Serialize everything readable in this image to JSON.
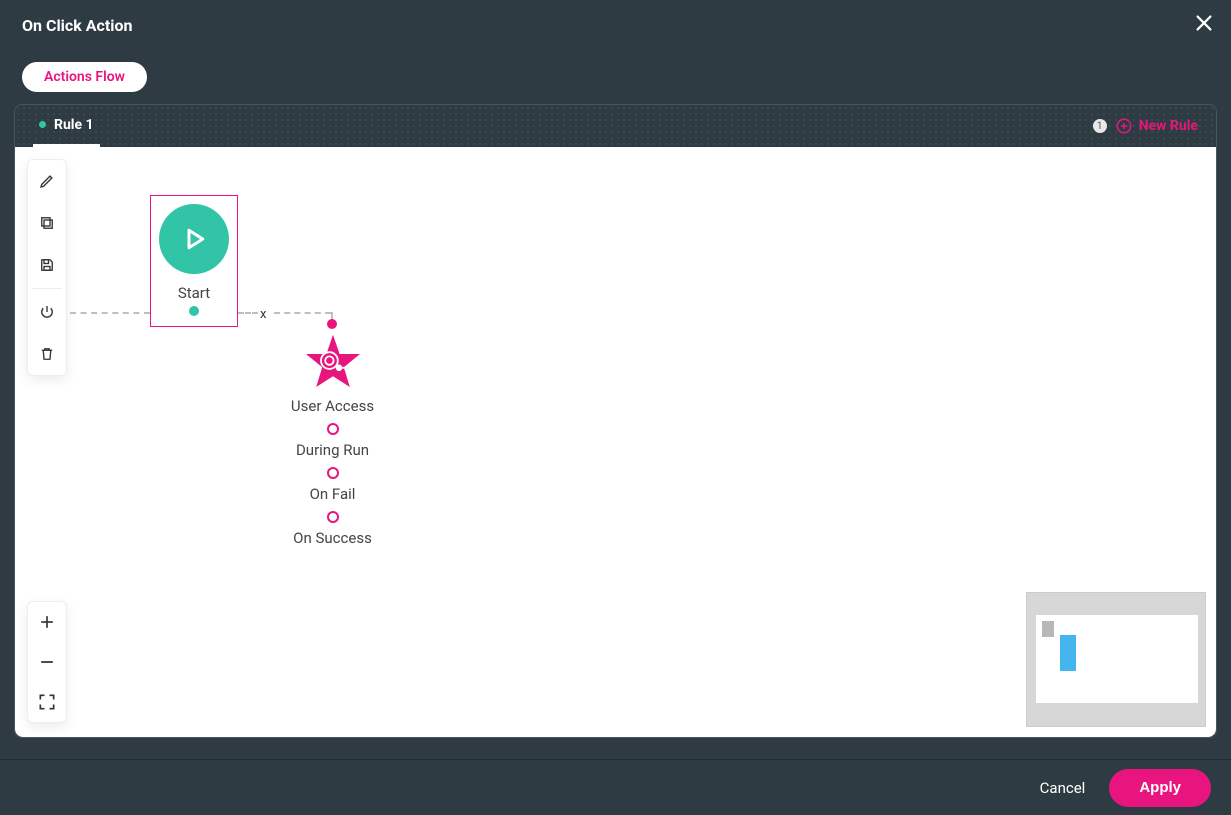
{
  "header": {
    "title": "On Click Action"
  },
  "tabs": {
    "actions_flow": "Actions Flow"
  },
  "rules": {
    "active_tab": "Rule 1",
    "new_rule_label": "New Rule",
    "count_badge": "1"
  },
  "nodes": {
    "start": {
      "label": "Start"
    },
    "action": {
      "title": "User Access",
      "during": "During Run",
      "on_fail": "On Fail",
      "on_success": "On Success"
    },
    "connector_x": "x"
  },
  "footer": {
    "cancel": "Cancel",
    "apply": "Apply"
  }
}
